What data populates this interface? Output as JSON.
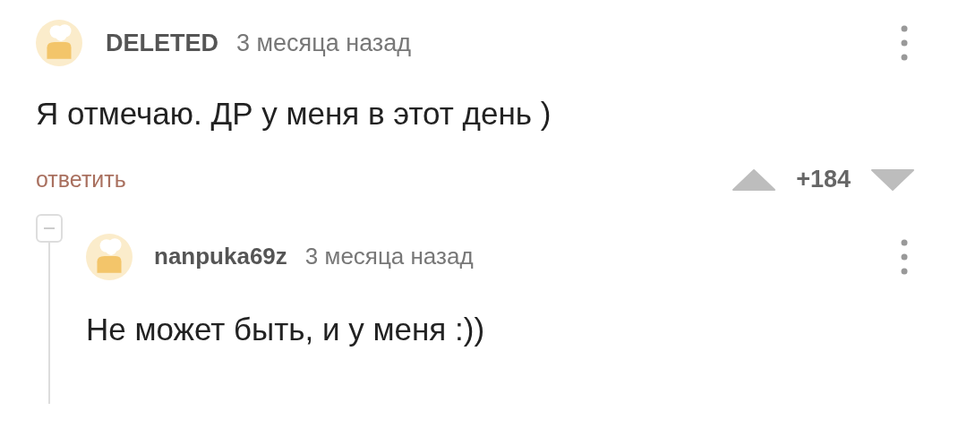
{
  "comments": [
    {
      "author": "DELETED",
      "time": "3 месяца назад",
      "text": "Я отмечаю. ДР у меня в этот день )",
      "reply_label": "ответить",
      "rating": "+184",
      "expanded": true,
      "children": [
        {
          "author": "nanpuka69z",
          "time": "3 месяца назад",
          "text": "Не может быть, и у меня :))"
        }
      ]
    }
  ]
}
